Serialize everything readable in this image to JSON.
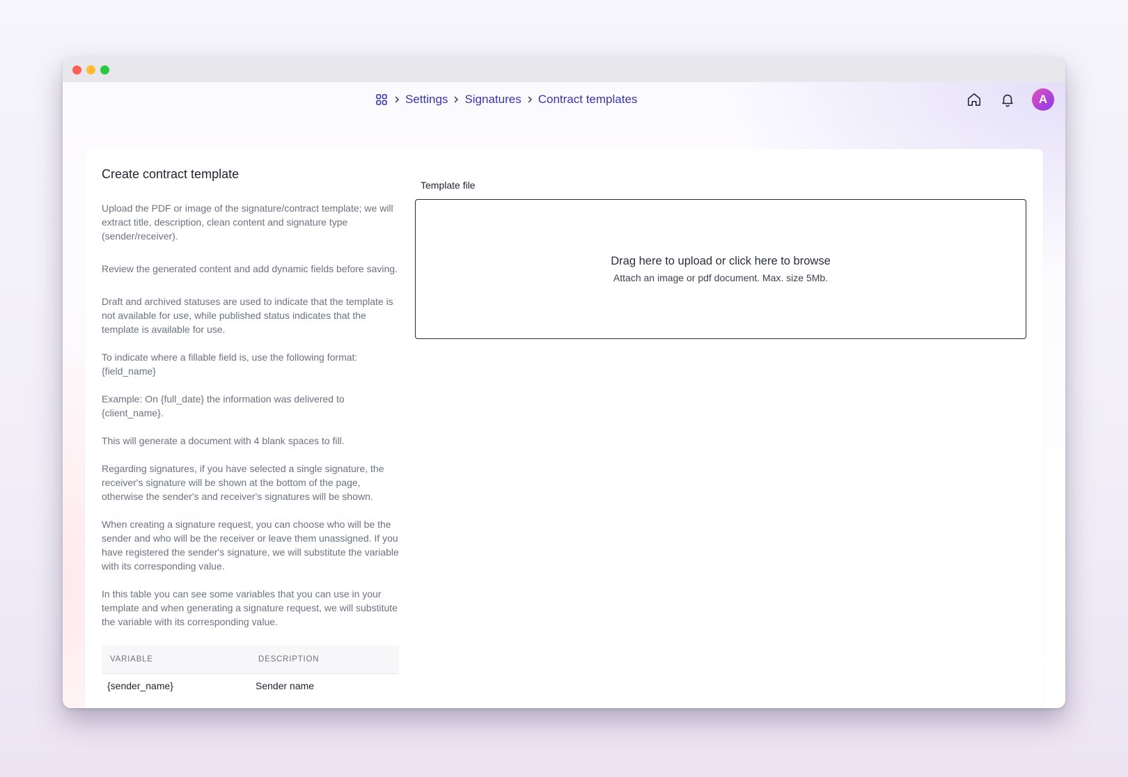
{
  "breadcrumb": {
    "home_icon": "grid-icon",
    "items": [
      "Settings",
      "Signatures",
      "Contract templates"
    ]
  },
  "nav": {
    "home_icon": "home-icon",
    "bell_icon": "bell-icon",
    "avatar_letter": "A"
  },
  "card": {
    "title": "Create contract template",
    "paragraphs": [
      "Upload the PDF or image of the signature/contract template; we will extract title, description, clean content and signature type (sender/receiver).",
      "Review the generated content and add dynamic fields before saving.",
      "Draft and archived statuses are used to indicate that the template is not available for use, while published status indicates that the template is available for use.",
      "To indicate where a fillable field is, use the following format: {field_name}",
      "Example: On {full_date} the information was delivered to {client_name}.",
      "This will generate a document with 4 blank spaces to fill.",
      "Regarding signatures, if you have selected a single signature, the receiver's signature will be shown at the bottom of the page, otherwise the sender's and receiver's signatures will be shown.",
      "When creating a signature request, you can choose who will be the sender and who will be the receiver or leave them unassigned. If you have registered the sender's signature, we will substitute the variable with its corresponding value.",
      "In this table you can see some variables that you can use in your template and when generating a signature request, we will substitute the variable with its corresponding value."
    ],
    "table": {
      "headers": [
        "VARIABLE",
        "DESCRIPTION"
      ],
      "rows": [
        {
          "variable": "{sender_name}",
          "description": "Sender name"
        }
      ]
    }
  },
  "upload": {
    "label": "Template file",
    "main_text": "Drag here to upload or click here to browse",
    "sub_text": "Attach an image or pdf document. Max. size 5Mb."
  },
  "colors": {
    "accent": "#3a34a8",
    "avatar_start": "#e14fb6",
    "avatar_end": "#8a3cf0"
  }
}
